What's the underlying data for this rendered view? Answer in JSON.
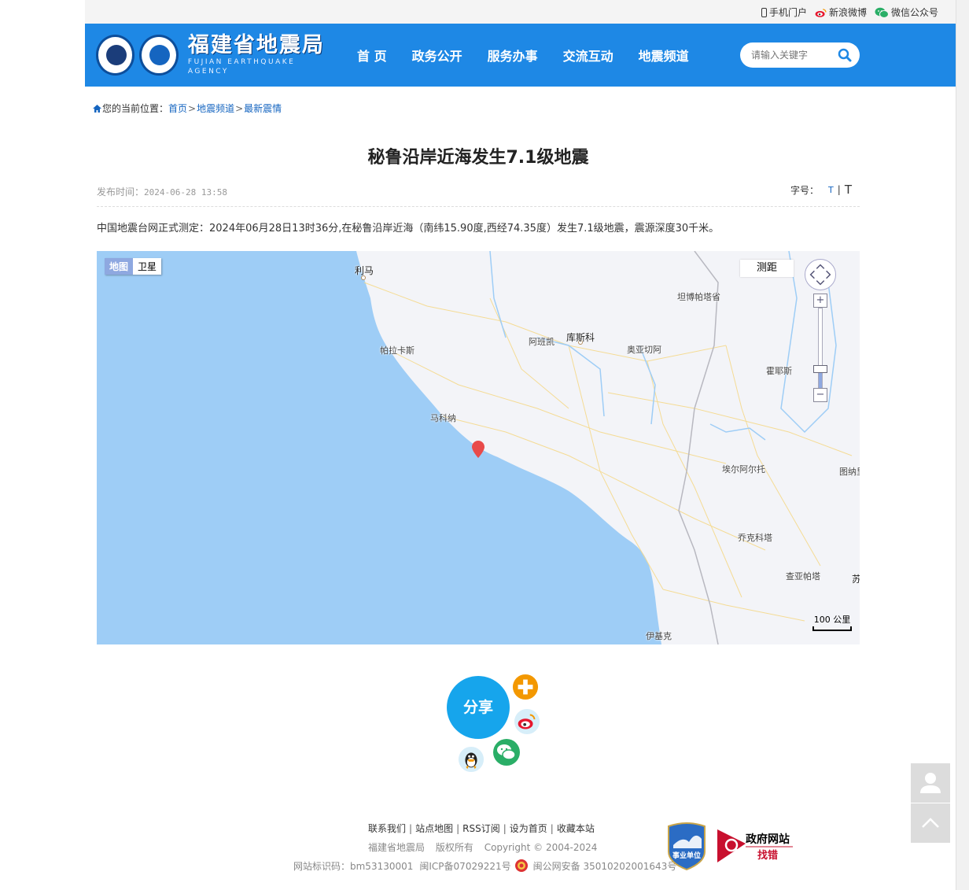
{
  "topbar": {
    "mobile": "手机门户",
    "weibo": "新浪微博",
    "wechat": "微信公众号"
  },
  "header": {
    "logo_cn": "福建省地震局",
    "logo_en": "FUJIAN EARTHQUAKE AGENCY",
    "nav": [
      "首 页",
      "政务公开",
      "服务办事",
      "交流互动",
      "地震频道"
    ],
    "search_placeholder": "请输入关键字",
    "brand_color": "#1e88e5"
  },
  "breadcrumb": {
    "prefix": "您的当前位置：",
    "items": [
      "首页",
      "地震频道",
      "最新震情"
    ],
    "sep": ">"
  },
  "article": {
    "title": "秘鲁沿岸近海发生7.1级地震",
    "pub_label": "发布时间：",
    "pub_time": "2024-06-28 13:58",
    "font_label": "字号：",
    "font_small": "T",
    "font_sep": "|",
    "font_large": "T",
    "body": "中国地震台网正式测定：2024年06月28日13时36分,在秘鲁沿岸近海（南纬15.90度,西经74.35度）发生7.1级地震，震源深度30千米。"
  },
  "map": {
    "type_map": "地图",
    "type_satellite": "卫星",
    "ruler": "测距",
    "zoom_in": "+",
    "zoom_out": "−",
    "scale": "100 公里",
    "zoom_level_fraction": 0.25,
    "places": {
      "lima": "利马",
      "tambopata": "坦博帕塔省",
      "abancay": "阿班凯",
      "cusco": "库斯科",
      "urcos": "奥亚切阿",
      "paracas": "帕拉卡斯",
      "juliaca": "霍耶斯",
      "marcona": "马科纳",
      "arequipa": "埃尔阿尔托",
      "tunari": "图纳里",
      "chuquito": "乔克科塔",
      "chayanta": "查亚帕塔",
      "su": "苏",
      "iquique": "伊基克"
    },
    "water_color": "#9ecdf6",
    "land_color": "#f3f4f8"
  },
  "share": {
    "label": "分享"
  },
  "footer": {
    "links": [
      "联系我们",
      "站点地图",
      "RSS订阅",
      "设为首页",
      "收藏本站"
    ],
    "org": "福建省地震局",
    "rights": "版权所有",
    "copyright": "Copyright © 2004-2024",
    "site_id": "网站标识码：bm53130001",
    "icp": "闽ICP备07029221号",
    "police": "闽公网安备 35010202001643号",
    "badge1_text": "事业单位",
    "badge2_title": "政府网站",
    "badge2_sub": "找错"
  }
}
